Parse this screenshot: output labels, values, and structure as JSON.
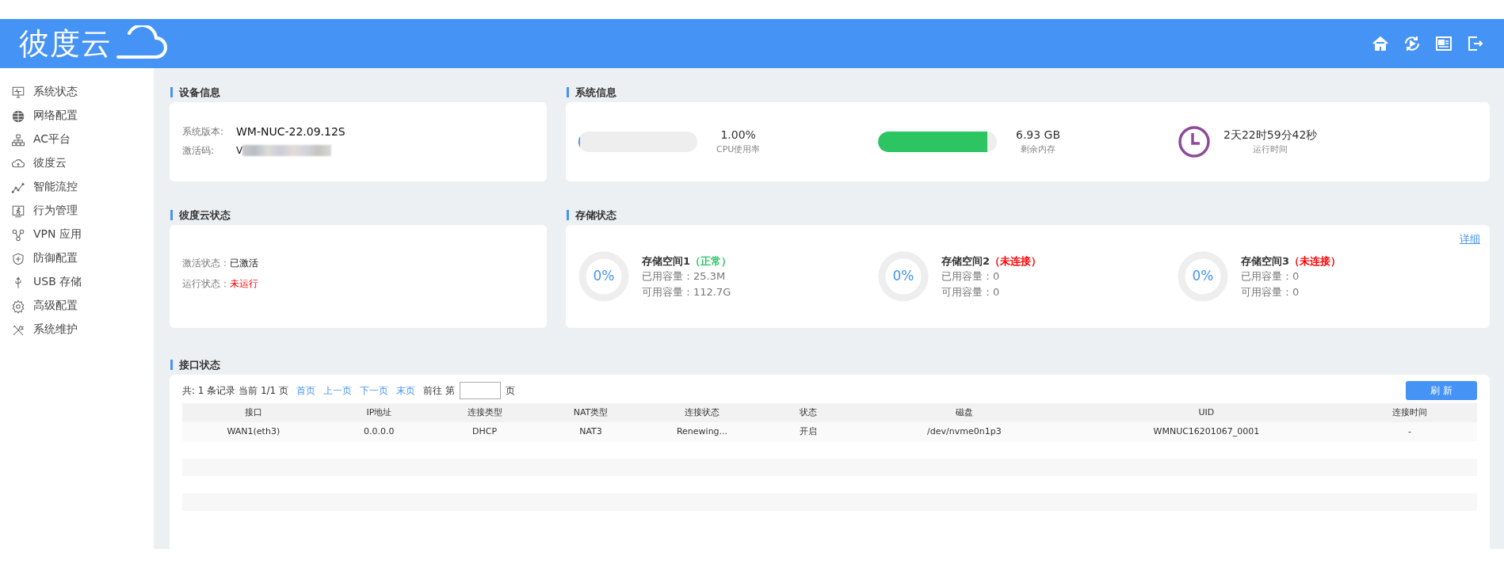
{
  "header": {
    "logo_text": "彼度云"
  },
  "sidebar": {
    "items": [
      {
        "label": "系统状态",
        "selected": false
      },
      {
        "label": "网络配置",
        "selected": false
      },
      {
        "label": "AC平台",
        "selected": false
      },
      {
        "label": "彼度云",
        "selected": false
      },
      {
        "label": "智能流控",
        "selected": false
      },
      {
        "label": "行为管理",
        "selected": false
      },
      {
        "label": "VPN 应用",
        "selected": false
      },
      {
        "label": "防御配置",
        "selected": false
      },
      {
        "label": "USB 存储",
        "selected": false
      },
      {
        "label": "高级配置",
        "selected": false
      },
      {
        "label": "系统维护",
        "selected": false
      }
    ]
  },
  "device_info": {
    "title": "设备信息",
    "fields": [
      {
        "label": "系统版本:",
        "value": "WM-NUC-22.09.12S"
      },
      {
        "label": "激活码:",
        "value": "V"
      }
    ]
  },
  "system_info": {
    "title": "系统信息",
    "cpu": {
      "level": 0.01,
      "reading": "1.00%",
      "caption": "CPU使用率"
    },
    "memory": {
      "level": 0.92,
      "reading": "6.93 GB",
      "caption": "剩余内存"
    },
    "uptime": {
      "reading": "2天22时59分42秒",
      "caption": "运行时间"
    }
  },
  "cloud_status": {
    "title": "彼度云状态",
    "fields": [
      {
        "label": "激活状态：",
        "value": "已激活",
        "ok": true
      },
      {
        "label": "运行状态：",
        "value": "未运行",
        "ok": false
      }
    ]
  },
  "storage_status": {
    "title": "存储状态",
    "detail_link": "详细",
    "spaces": [
      {
        "name": "存储空间1",
        "status": "（正常）",
        "connected": true,
        "percent": "0%",
        "used": "已用容量：25.3M",
        "free": "可用容量：112.7G"
      },
      {
        "name": "存储空间2",
        "status": "（未连接）",
        "connected": false,
        "percent": "0%",
        "used": "已用容量：0",
        "free": "可用容量：0"
      },
      {
        "name": "存储空间3",
        "status": "（未连接）",
        "connected": false,
        "percent": "0%",
        "used": "已用容量：0",
        "free": "可用容量：0"
      }
    ]
  },
  "interface_status": {
    "title": "接口状态",
    "summary": "共: 1 条记录 当前 1/1 页",
    "pager": [
      "首页",
      "上一页",
      "下一页",
      "末页"
    ],
    "goto_label": "前往 第",
    "goto_suffix": "页",
    "refresh_button": "刷 新",
    "table": {
      "columns": [
        "接口",
        "IP地址",
        "连接类型",
        "NAT类型",
        "连接状态",
        "状态",
        "磁盘",
        "UID",
        "连接时间"
      ],
      "rows": [
        [
          "WAN1(eth3)",
          "0.0.0.0",
          "DHCP",
          "NAT3",
          "Renewing...",
          "开启",
          "/dev/nvme0n1p3",
          "WMNUC16201067_0001",
          "-"
        ]
      ]
    }
  }
}
